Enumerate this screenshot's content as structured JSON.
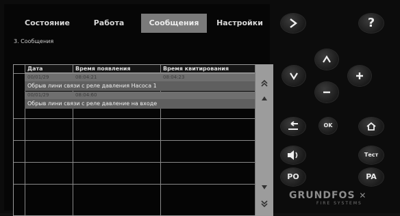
{
  "tabs": {
    "status": "Состояние",
    "work": "Работа",
    "messages": "Сообщения",
    "settings": "Настройки"
  },
  "breadcrumb": "3. Сообщения",
  "table": {
    "columns": [
      "Дата",
      "Время появления",
      "Время квитирования"
    ],
    "rows": [
      {
        "date": "00/01/29",
        "appear": "08:04:21",
        "ack": "08:04:23",
        "message": "Обрыв лини связи с реле давления Насоса 1"
      },
      {
        "date": "00/01/29",
        "appear": "08:04:60",
        "ack": "",
        "message": "Обрыв лини связи с реле давление на входе"
      }
    ]
  },
  "buttons": {
    "ok": "OK",
    "test": "Тест",
    "po": "PO",
    "pa": "PA",
    "help": "?"
  },
  "logo": {
    "brand": "GRUNDFOS",
    "subtitle": "FIRE SYSTEMS"
  }
}
